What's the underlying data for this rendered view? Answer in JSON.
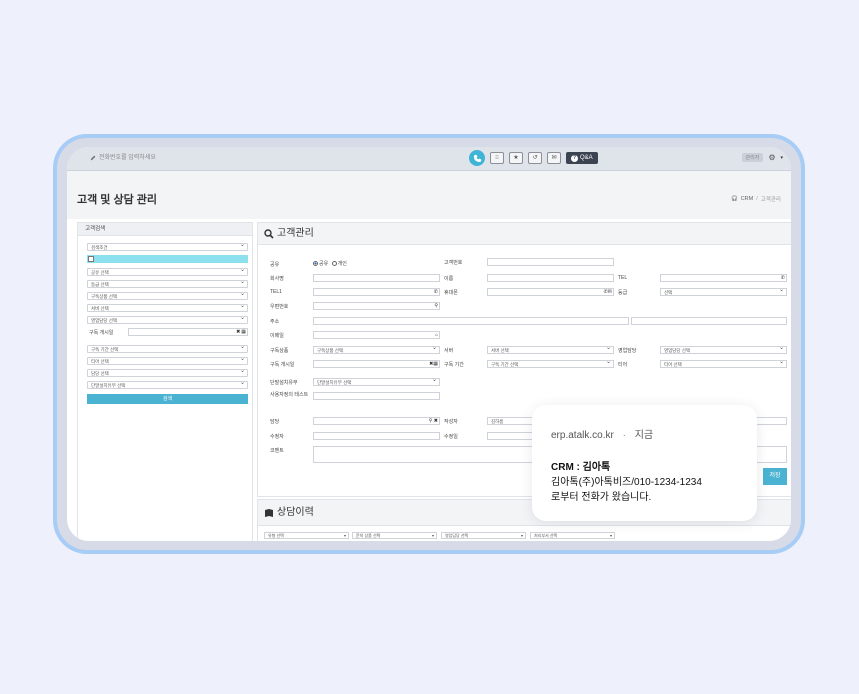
{
  "topbar": {
    "phone_placeholder": "전화번호를 입력하세요",
    "qa_label": "Q&A",
    "user_name": "관리자"
  },
  "page": {
    "title": "고객 및 상담 관리",
    "breadcrumb": [
      "CRM",
      "고객관리"
    ]
  },
  "sidebar": {
    "title": "고객검색",
    "condition": "검색조건",
    "selects_a": [
      "공유 선택",
      "등급 선택",
      "구독상품 선택",
      "서버 선택",
      "영업담당 선택"
    ],
    "date_label": "구독 개시일",
    "selects_b": [
      "구독 기간 선택",
      "티어 선택",
      "담당 선택",
      "단말설치유무 선택"
    ],
    "search_label": "검색"
  },
  "customer": {
    "title": "고객관리",
    "labels": {
      "share": "공유",
      "company": "회사명",
      "tel1": "TEL1",
      "zip": "우편번호",
      "address": "주소",
      "email": "이메일",
      "product": "구독상품",
      "start_date": "구독 개시일",
      "device": "단말설치유무",
      "reg_no": "사용자정의 테스트",
      "owner": "담당",
      "modifier": "수정자",
      "comment": "코멘트",
      "cust_no": "고객번호",
      "name": "이름",
      "mobile": "휴대폰",
      "server": "서버",
      "period": "구독 기간",
      "writer": "작성자",
      "modified": "수정일",
      "tel": "TEL",
      "grade": "등급",
      "sales": "영업담당",
      "tier": "티어"
    },
    "share_options": [
      "공유",
      "개인"
    ],
    "values": {
      "product": "구독상품 선택",
      "server": "서버 선택",
      "period": "구독 기간 선택",
      "device": "단말설치유무 선택",
      "grade": "선택",
      "sales": "영업담당 선택",
      "tier": "티어 선택",
      "writer": "김하름"
    },
    "save_label": "저장"
  },
  "history": {
    "title": "상담이력",
    "filters": [
      "유형 선택",
      "문의 상품 선택",
      "영업담당 선택",
      "처리부서 선택"
    ]
  },
  "notification": {
    "source": "erp.atalk.co.kr",
    "time": "지금",
    "title": "CRM : 김아톡",
    "line1": "김아톡(주)아톡비즈/010-1234-1234",
    "line2": "로부터 전화가 왔습니다."
  },
  "colors": {
    "background": "#eef0fc",
    "device_frame": "#a7ccf5",
    "accent": "#4ab3d1"
  }
}
